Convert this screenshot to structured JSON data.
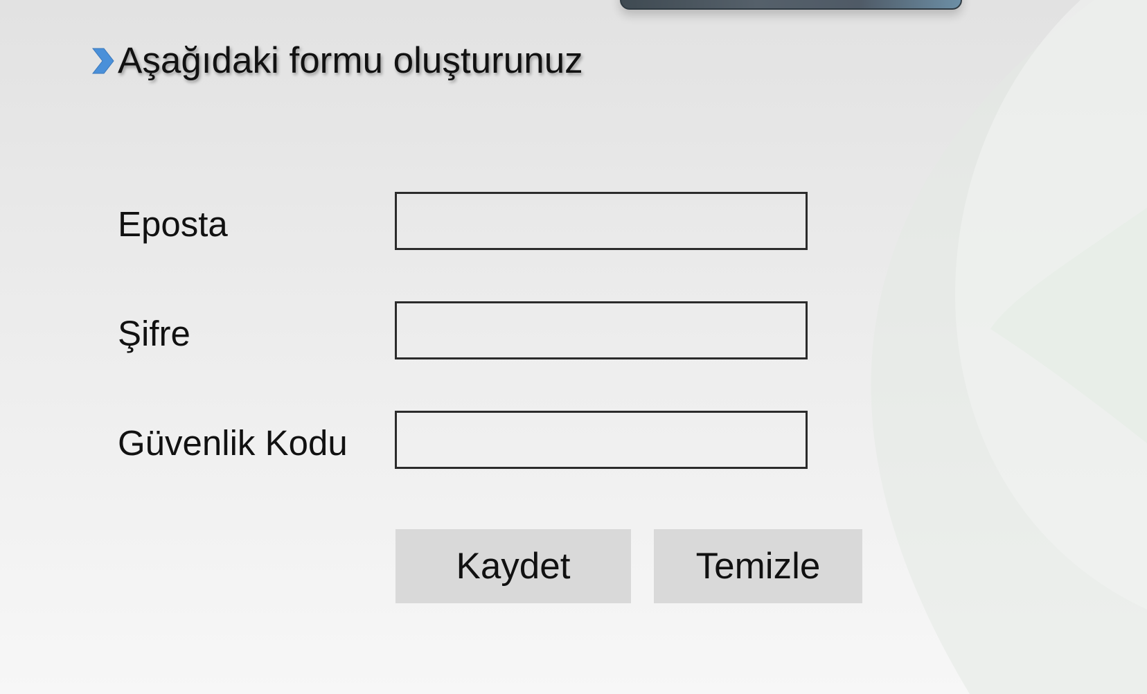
{
  "heading": {
    "text": "Aşağıdaki formu oluşturunuz",
    "icon": "chevron-right-icon"
  },
  "form": {
    "fields": [
      {
        "label": "Eposta",
        "value": "",
        "placeholder": ""
      },
      {
        "label": "Şifre",
        "value": "",
        "placeholder": ""
      },
      {
        "label": "Güvenlik Kodu",
        "value": "",
        "placeholder": ""
      }
    ],
    "buttons": {
      "save_label": "Kaydet",
      "clear_label": "Temizle"
    }
  },
  "colors": {
    "accent_icon": "#4a90d9",
    "button_bg": "#d9d9d9",
    "input_border": "#2b2b2b",
    "decor_green": "#dfeadf"
  }
}
